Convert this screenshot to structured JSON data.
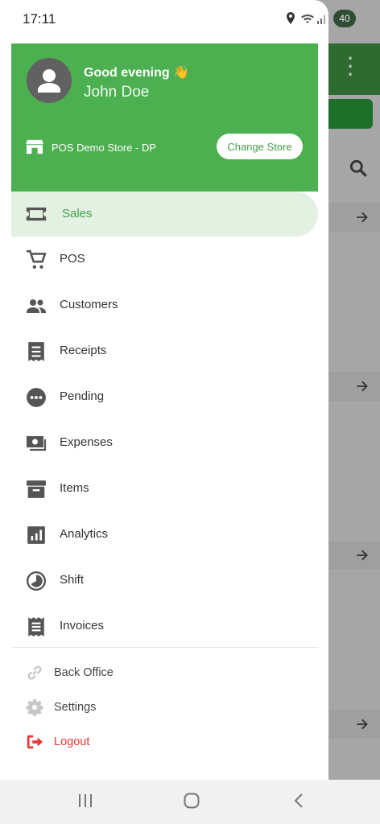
{
  "status_bar": {
    "time": "17:11",
    "battery": "40"
  },
  "header": {
    "greeting": "Good evening 👋",
    "user_name": "John Doe",
    "store_name": "POS Demo Store - DP",
    "change_store_label": "Change Store"
  },
  "menu": {
    "items": [
      {
        "label": "Sales",
        "icon": "sales-ticket-icon",
        "active": true
      },
      {
        "label": "POS",
        "icon": "cart-icon"
      },
      {
        "label": "Customers",
        "icon": "people-icon"
      },
      {
        "label": "Receipts",
        "icon": "receipt-icon"
      },
      {
        "label": "Pending",
        "icon": "more-circle-icon"
      },
      {
        "label": "Expenses",
        "icon": "money-icon"
      },
      {
        "label": "Items",
        "icon": "archive-box-icon"
      },
      {
        "label": "Analytics",
        "icon": "bar-chart-icon"
      },
      {
        "label": "Shift",
        "icon": "clock-half-icon"
      },
      {
        "label": "Invoices",
        "icon": "invoice-icon"
      }
    ]
  },
  "lower_menu": {
    "back_office": "Back Office",
    "settings": "Settings",
    "logout": "Logout"
  },
  "colors": {
    "primary": "#4caf50",
    "active_text": "#43a047",
    "active_bg": "#e3f1e3",
    "logout": "#e53935"
  }
}
